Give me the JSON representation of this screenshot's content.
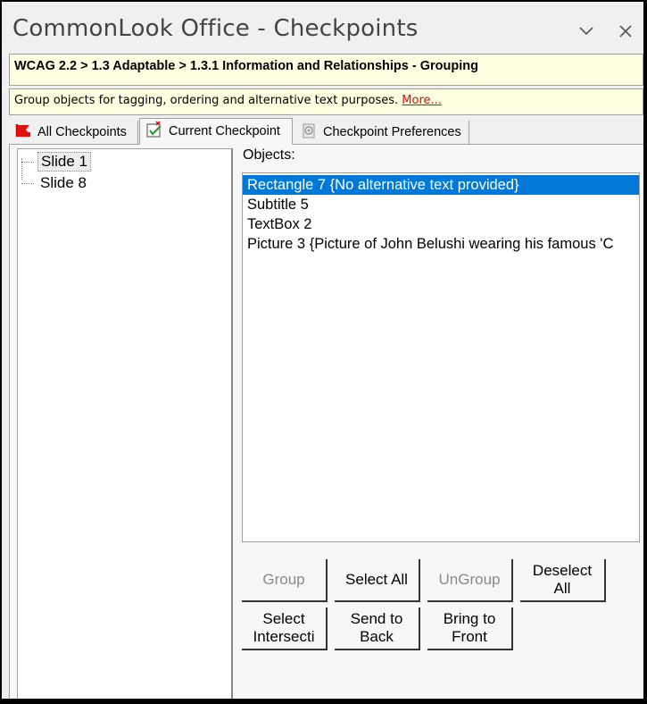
{
  "window": {
    "title": "CommonLook Office - Checkpoints",
    "minimize_icon": "chevron-down-icon",
    "close_icon": "close-icon"
  },
  "breadcrumb": "WCAG 2.2 > 1.3 Adaptable > 1.3.1 Information and Relationships - Grouping",
  "description": {
    "text": "Group objects for tagging, ordering and alternative text purposes. ",
    "more_link": "More..."
  },
  "tabs": [
    {
      "label": "All Checkpoints",
      "icon": "flag-icon",
      "active": false
    },
    {
      "label": "Current Checkpoint",
      "icon": "checkpoint-check-icon",
      "active": true
    },
    {
      "label": "Checkpoint Preferences",
      "icon": "preferences-gear-icon",
      "active": false
    }
  ],
  "tree": {
    "items": [
      {
        "label": "Slide 1",
        "selected": true
      },
      {
        "label": "Slide 8",
        "selected": false
      }
    ]
  },
  "objects": {
    "label": "Objects:",
    "items": [
      {
        "label": "Rectangle 7 {No alternative text provided}",
        "selected": true
      },
      {
        "label": "Subtitle 5",
        "selected": false
      },
      {
        "label": "TextBox 2",
        "selected": false
      },
      {
        "label": "Picture 3 {Picture of John Belushi wearing his famous 'C",
        "selected": false
      }
    ]
  },
  "buttons": {
    "group": "Group",
    "select_all": "Select All",
    "ungroup": "UnGroup",
    "deselect_all": "Deselect\nAll",
    "select_intersecting": "Select\nIntersecti",
    "send_to_back": "Send to\nBack",
    "bring_to_front": "Bring to\nFront"
  },
  "colors": {
    "selection": "#0078d7",
    "info_background": "#ffffe1",
    "link": "#d01010"
  }
}
